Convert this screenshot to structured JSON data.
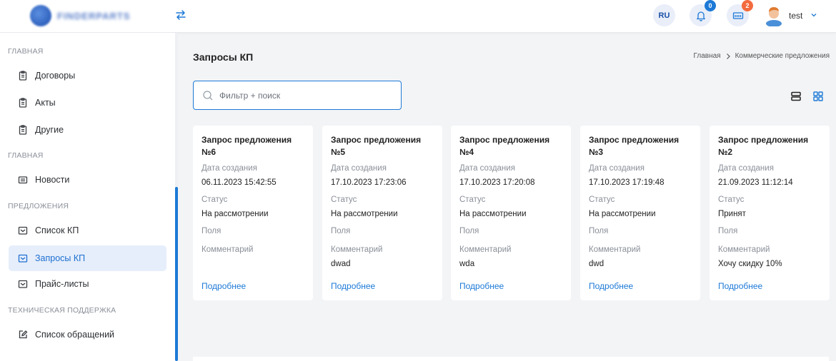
{
  "header": {
    "logo_text": "FINDERPARTS",
    "lang": "RU",
    "notifications_count": "0",
    "cart_count": "2",
    "user_name": "test"
  },
  "sidebar": {
    "sections": [
      {
        "label": "ГЛАВНАЯ"
      },
      {
        "label": "ГЛАВНАЯ"
      },
      {
        "label": "ПРЕДЛОЖЕНИЯ"
      },
      {
        "label": "ТЕХНИЧЕСКАЯ ПОДДЕРЖКА"
      }
    ],
    "items": [
      {
        "label": "Договоры",
        "icon": "clipboard-icon"
      },
      {
        "label": "Акты",
        "icon": "clipboard-icon"
      },
      {
        "label": "Другие",
        "icon": "clipboard-icon"
      },
      {
        "label": "Новости",
        "icon": "newspaper-icon"
      },
      {
        "label": "Список КП",
        "icon": "inbox-icon"
      },
      {
        "label": "Запросы КП",
        "icon": "inbox-icon",
        "active": true
      },
      {
        "label": "Прайс-листы",
        "icon": "inbox-icon"
      },
      {
        "label": "Список обращений",
        "icon": "edit-icon"
      }
    ]
  },
  "main": {
    "title": "Запросы КП",
    "breadcrumb": [
      "Главная",
      "Коммерческие предложения"
    ],
    "search_placeholder": "Фильтр + поиск"
  },
  "card_labels": {
    "date": "Дата создания",
    "status": "Статус",
    "fields": "Поля",
    "comment": "Комментарий",
    "more": "Подробнее"
  },
  "cards": [
    {
      "title_line1": "Запрос предложения",
      "title_line2": "№6",
      "date": "06.11.2023 15:42:55",
      "status": "На рассмотрении",
      "comment": ""
    },
    {
      "title_line1": "Запрос предложения",
      "title_line2": "№5",
      "date": "17.10.2023 17:23:06",
      "status": "На рассмотрении",
      "comment": "dwad"
    },
    {
      "title_line1": "Запрос предложения",
      "title_line2": "№4",
      "date": "17.10.2023 17:20:08",
      "status": "На рассмотрении",
      "comment": "wda"
    },
    {
      "title_line1": "Запрос предложения",
      "title_line2": "№3",
      "date": "17.10.2023 17:19:48",
      "status": "На рассмотрении",
      "comment": "dwd"
    },
    {
      "title_line1": "Запрос предложения",
      "title_line2": "№2",
      "date": "21.09.2023 11:12:14",
      "status": "Принят",
      "comment": "Хочу скидку 10%"
    }
  ]
}
